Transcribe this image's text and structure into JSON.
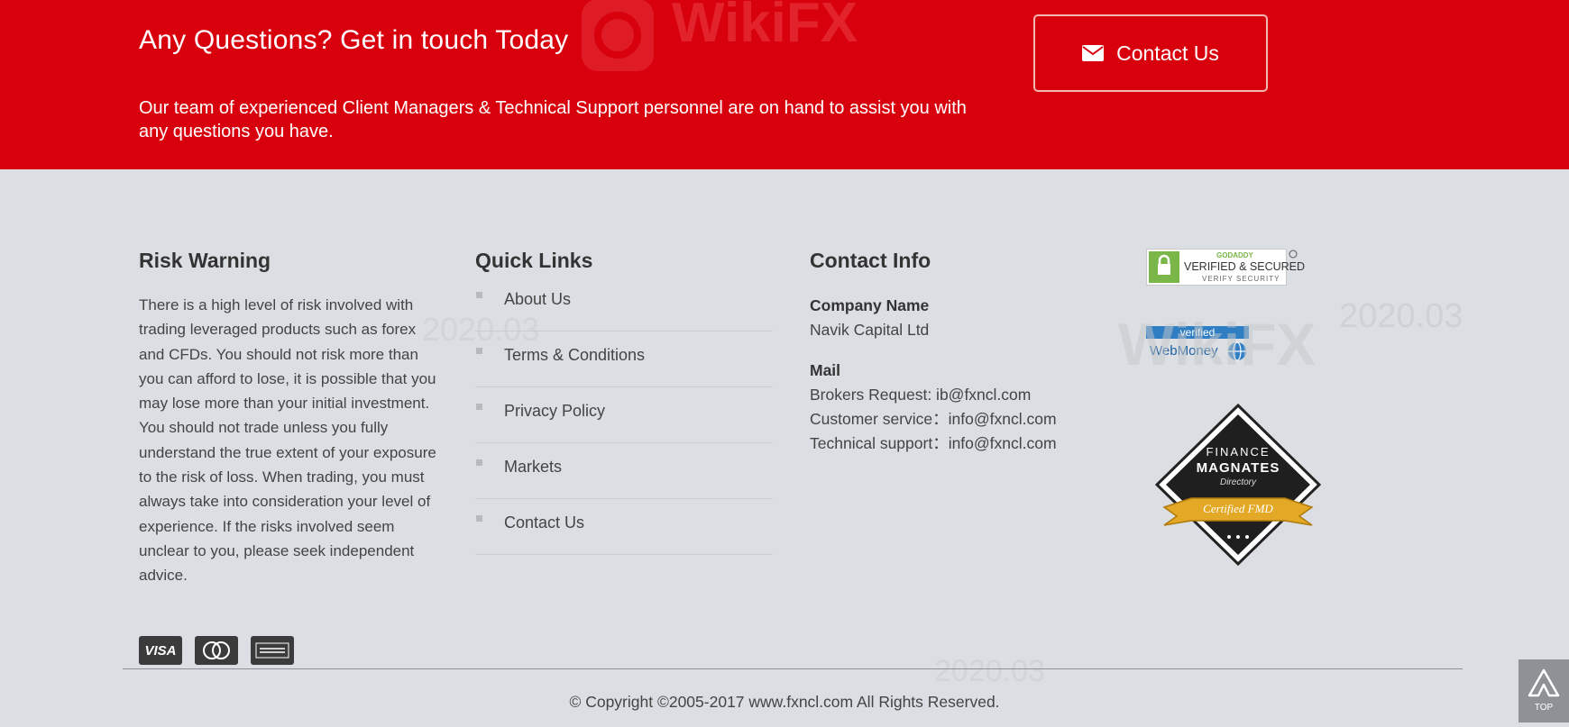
{
  "banner": {
    "title": "Any Questions? Get in touch Today",
    "text": "Our team of experienced Client Managers & Technical Support personnel are on hand to assist you with any questions you have.",
    "contact_button": "Contact Us"
  },
  "risk_warning": {
    "title": "Risk Warning",
    "text": "There is a high level of risk involved with trading leveraged products such as forex and CFDs. You should not risk more than you can afford to lose, it is possible that you may lose more than your initial investment. You should not trade unless you fully understand the true extent of your exposure to the risk of loss. When trading, you must always take into consideration your level of experience. If the risks involved seem unclear to you, please seek independent advice."
  },
  "quick_links": {
    "title": "Quick Links",
    "items": [
      "About Us",
      "Terms & Conditions",
      "Privacy Policy",
      "Markets",
      "Contact Us"
    ]
  },
  "contact_info": {
    "title": "Contact Info",
    "company_label": "Company Name",
    "company_value": "Navik Capital Ltd",
    "mail_label": "Mail",
    "lines": [
      "Brokers Request: ib@fxncl.com",
      "Customer service：info@fxncl.com",
      "Technical support：info@fxncl.com"
    ]
  },
  "badges": {
    "godaddy_top": "GODADDY",
    "godaddy_main": "VERIFIED & SECURED",
    "godaddy_sub": "VERIFY SECURITY",
    "webmoney_top": "verified",
    "webmoney_main": "WebMoney",
    "fm_line1": "FINANCE",
    "fm_line2": "MAGNATES",
    "fm_line3": "Directory",
    "fm_ribbon": "Certified FMD"
  },
  "cards": [
    "VISA",
    "mastercard",
    "amex"
  ],
  "copyright": "© Copyright ©2005-2017 www.fxncl.com All Rights Reserved.",
  "top_button": "TOP",
  "watermark": {
    "brand": "WikiFX",
    "date": "2020.03"
  },
  "colors": {
    "banner_red": "#d9000d",
    "footer_bg": "#dbdee2",
    "text": "#444444"
  }
}
